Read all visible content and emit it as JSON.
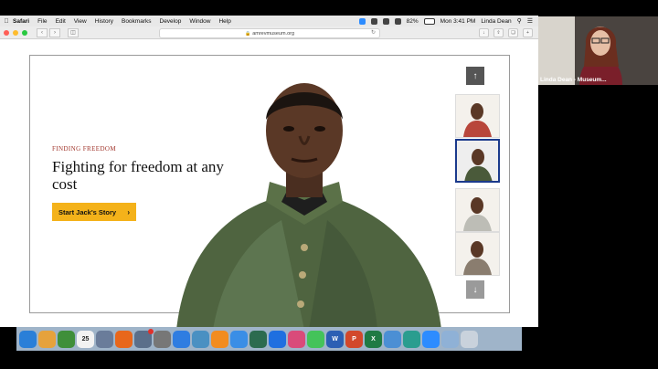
{
  "menubar": {
    "items": [
      "Safari",
      "File",
      "Edit",
      "View",
      "History",
      "Bookmarks",
      "Develop",
      "Window",
      "Help"
    ],
    "battery": "82%",
    "clock": "Mon 3:41 PM",
    "user": "Linda Dean"
  },
  "browser": {
    "url": "amrevmuseum.org"
  },
  "hero": {
    "kicker": "FINDING FREEDOM",
    "headline": "Fighting for freedom at any cost",
    "cta_label": "Start Jack's Story"
  },
  "thumbnails": [
    {
      "name": "thumb-woman-red-dress",
      "active": false,
      "color": "#b8463b"
    },
    {
      "name": "thumb-jack",
      "active": true,
      "color": "#4a5a3a"
    },
    {
      "name": "thumb-woman-gray",
      "active": false,
      "color": "#bdbdb6"
    },
    {
      "name": "thumb-man-hat",
      "active": false,
      "color": "#8a7d6f"
    }
  ],
  "video": {
    "participant_name": "Linda Dean - Museum..."
  },
  "dock": {
    "icons": [
      {
        "name": "finder-icon",
        "color": "#2a7fd8",
        "label": ""
      },
      {
        "name": "photos-icon",
        "color": "#e6a23c",
        "label": ""
      },
      {
        "name": "chrome-icon",
        "color": "#3f8f3a",
        "label": ""
      },
      {
        "name": "calendar-icon",
        "color": "#f2f2f2",
        "label": "25"
      },
      {
        "name": "preview-icon",
        "color": "#6a7c9a",
        "label": ""
      },
      {
        "name": "firefox-icon",
        "color": "#e8671c",
        "label": ""
      },
      {
        "name": "image-capture-icon",
        "color": "#5b6f8a",
        "label": ""
      },
      {
        "name": "system-preferences-icon",
        "color": "#777",
        "label": ""
      },
      {
        "name": "app-store-icon",
        "color": "#2f7de1",
        "label": ""
      },
      {
        "name": "gallery-icon",
        "color": "#4a90c2",
        "label": ""
      },
      {
        "name": "books-icon",
        "color": "#f28c1f",
        "label": ""
      },
      {
        "name": "safari-icon",
        "color": "#3a8ee6",
        "label": ""
      },
      {
        "name": "time-machine-icon",
        "color": "#2c6b4f",
        "label": ""
      },
      {
        "name": "dropbox-icon",
        "color": "#1f6fe0",
        "label": ""
      },
      {
        "name": "firefox-dev-icon",
        "color": "#d94b7a",
        "label": ""
      },
      {
        "name": "messages-icon",
        "color": "#44c35a",
        "label": ""
      },
      {
        "name": "word-icon",
        "color": "#2b5fb4",
        "label": "W"
      },
      {
        "name": "powerpoint-icon",
        "color": "#d2482b",
        "label": "P"
      },
      {
        "name": "excel-icon",
        "color": "#1f7a44",
        "label": "X"
      },
      {
        "name": "audio-icon",
        "color": "#4b8fd4",
        "label": ""
      },
      {
        "name": "edge-icon",
        "color": "#2a9d8f",
        "label": ""
      },
      {
        "name": "zoom-icon",
        "color": "#2d8cff",
        "label": ""
      },
      {
        "name": "display-icon",
        "color": "#8fb1d6",
        "label": ""
      },
      {
        "name": "trash-icon",
        "color": "#c9d2dc",
        "label": ""
      }
    ]
  }
}
